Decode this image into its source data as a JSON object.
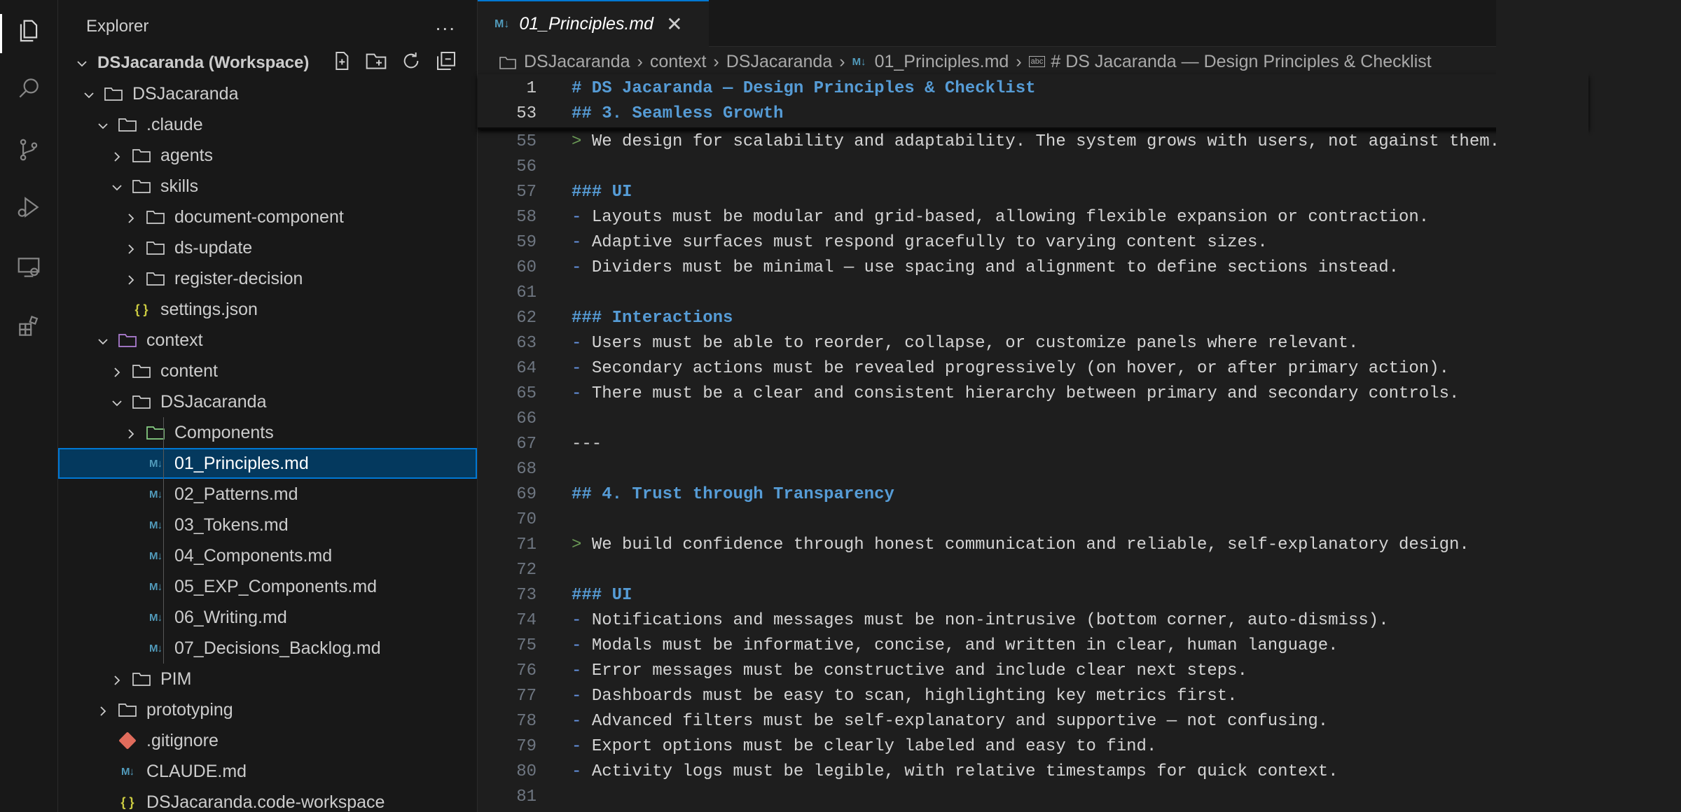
{
  "sidebar": {
    "title": "Explorer",
    "more": "...",
    "tree": [
      {
        "label": "DSJacaranda (Workspace)",
        "depth": 0,
        "type": "workspace",
        "expanded": true
      },
      {
        "label": "DSJacaranda",
        "depth": 1,
        "type": "folder",
        "expanded": true
      },
      {
        "label": ".claude",
        "depth": 2,
        "type": "folder",
        "expanded": true
      },
      {
        "label": "agents",
        "depth": 3,
        "type": "folder",
        "expanded": false
      },
      {
        "label": "skills",
        "depth": 3,
        "type": "folder",
        "expanded": true
      },
      {
        "label": "document-component",
        "depth": 4,
        "type": "folder",
        "expanded": false
      },
      {
        "label": "ds-update",
        "depth": 4,
        "type": "folder",
        "expanded": false
      },
      {
        "label": "register-decision",
        "depth": 4,
        "type": "folder",
        "expanded": false
      },
      {
        "label": "settings.json",
        "depth": 3,
        "type": "json"
      },
      {
        "label": "context",
        "depth": 2,
        "type": "folder-special",
        "expanded": true
      },
      {
        "label": "content",
        "depth": 3,
        "type": "folder",
        "expanded": false
      },
      {
        "label": "DSJacaranda",
        "depth": 3,
        "type": "folder",
        "expanded": true
      },
      {
        "label": "Components",
        "depth": 4,
        "type": "folder-comp",
        "expanded": false
      },
      {
        "label": "01_Principles.md",
        "depth": 4,
        "type": "md",
        "selected": true
      },
      {
        "label": "02_Patterns.md",
        "depth": 4,
        "type": "md"
      },
      {
        "label": "03_Tokens.md",
        "depth": 4,
        "type": "md"
      },
      {
        "label": "04_Components.md",
        "depth": 4,
        "type": "md"
      },
      {
        "label": "05_EXP_Components.md",
        "depth": 4,
        "type": "md"
      },
      {
        "label": "06_Writing.md",
        "depth": 4,
        "type": "md"
      },
      {
        "label": "07_Decisions_Backlog.md",
        "depth": 4,
        "type": "md"
      },
      {
        "label": "PIM",
        "depth": 3,
        "type": "folder",
        "expanded": false
      },
      {
        "label": "prototyping",
        "depth": 2,
        "type": "folder",
        "expanded": false
      },
      {
        "label": ".gitignore",
        "depth": 2,
        "type": "git"
      },
      {
        "label": "CLAUDE.md",
        "depth": 2,
        "type": "md"
      },
      {
        "label": "DSJacaranda.code-workspace",
        "depth": 2,
        "type": "json"
      }
    ]
  },
  "tab": {
    "icon": "M↓",
    "label": "01_Principles.md",
    "close": "✕"
  },
  "breadcrumb": {
    "parts": [
      "DSJacaranda",
      "context",
      "DSJacaranda",
      "01_Principles.md",
      "# DS Jacaranda — Design Principles & Checklist"
    ],
    "md_icon": "M↓",
    "symbol_icon": "abc"
  },
  "sticky_lines": [
    {
      "n": "1",
      "segments": [
        {
          "t": "# DS Jacaranda — Design Principles & Checklist",
          "c": "h"
        }
      ]
    },
    {
      "n": "53",
      "segments": [
        {
          "t": "## 3. Seamless Growth",
          "c": "h"
        }
      ]
    }
  ],
  "code_lines": [
    {
      "n": "55",
      "segments": [
        {
          "t": "> ",
          "c": "q"
        },
        {
          "t": "We design for scalability and adaptability. The system grows with users, not against them.",
          "c": ""
        }
      ]
    },
    {
      "n": "56",
      "segments": []
    },
    {
      "n": "57",
      "segments": [
        {
          "t": "### UI",
          "c": "h"
        }
      ]
    },
    {
      "n": "58",
      "segments": [
        {
          "t": "- ",
          "c": "d"
        },
        {
          "t": "Layouts must be modular and grid-based, allowing flexible expansion or contraction.",
          "c": ""
        }
      ]
    },
    {
      "n": "59",
      "segments": [
        {
          "t": "- ",
          "c": "d"
        },
        {
          "t": "Adaptive surfaces must respond gracefully to varying content sizes.",
          "c": ""
        }
      ]
    },
    {
      "n": "60",
      "segments": [
        {
          "t": "- ",
          "c": "d"
        },
        {
          "t": "Dividers must be minimal — use spacing and alignment to define sections instead.",
          "c": ""
        }
      ]
    },
    {
      "n": "61",
      "segments": []
    },
    {
      "n": "62",
      "segments": [
        {
          "t": "### Interactions",
          "c": "h"
        }
      ]
    },
    {
      "n": "63",
      "segments": [
        {
          "t": "- ",
          "c": "d"
        },
        {
          "t": "Users must be able to reorder, collapse, or customize panels where relevant.",
          "c": ""
        }
      ]
    },
    {
      "n": "64",
      "segments": [
        {
          "t": "- ",
          "c": "d"
        },
        {
          "t": "Secondary actions must be revealed progressively (on hover, or after primary action).",
          "c": ""
        }
      ]
    },
    {
      "n": "65",
      "segments": [
        {
          "t": "- ",
          "c": "d"
        },
        {
          "t": "There must be a clear and consistent hierarchy between primary and secondary controls.",
          "c": ""
        }
      ]
    },
    {
      "n": "66",
      "segments": []
    },
    {
      "n": "67",
      "segments": [
        {
          "t": "---",
          "c": ""
        }
      ]
    },
    {
      "n": "68",
      "segments": []
    },
    {
      "n": "69",
      "segments": [
        {
          "t": "## 4. Trust through Transparency",
          "c": "h"
        }
      ]
    },
    {
      "n": "70",
      "segments": []
    },
    {
      "n": "71",
      "segments": [
        {
          "t": "> ",
          "c": "q"
        },
        {
          "t": "We build confidence through honest communication and reliable, self-explanatory design.",
          "c": ""
        }
      ]
    },
    {
      "n": "72",
      "segments": []
    },
    {
      "n": "73",
      "segments": [
        {
          "t": "### UI",
          "c": "h"
        }
      ]
    },
    {
      "n": "74",
      "segments": [
        {
          "t": "- ",
          "c": "d"
        },
        {
          "t": "Notifications and messages must be non-intrusive (bottom corner, auto-dismiss).",
          "c": ""
        }
      ]
    },
    {
      "n": "75",
      "segments": [
        {
          "t": "- ",
          "c": "d"
        },
        {
          "t": "Modals must be informative, concise, and written in clear, human language.",
          "c": ""
        }
      ]
    },
    {
      "n": "76",
      "segments": [
        {
          "t": "- ",
          "c": "d"
        },
        {
          "t": "Error messages must be constructive and include clear next steps.",
          "c": ""
        }
      ]
    },
    {
      "n": "77",
      "segments": [
        {
          "t": "- ",
          "c": "d"
        },
        {
          "t": "Dashboards must be easy to scan, highlighting key metrics first.",
          "c": ""
        }
      ]
    },
    {
      "n": "78",
      "segments": [
        {
          "t": "- ",
          "c": "d"
        },
        {
          "t": "Advanced filters must be self-explanatory and supportive — not confusing.",
          "c": ""
        }
      ]
    },
    {
      "n": "79",
      "segments": [
        {
          "t": "- ",
          "c": "d"
        },
        {
          "t": "Export options must be clearly labeled and easy to find.",
          "c": ""
        }
      ]
    },
    {
      "n": "80",
      "segments": [
        {
          "t": "- ",
          "c": "d"
        },
        {
          "t": "Activity logs must be legible, with relative timestamps for quick context.",
          "c": ""
        }
      ]
    },
    {
      "n": "81",
      "segments": []
    }
  ],
  "colors": {
    "accent": "#0078d4",
    "selection": "#04395e",
    "heading": "#569cd6",
    "quote": "#6a9955",
    "md_icon": "#519aba"
  }
}
